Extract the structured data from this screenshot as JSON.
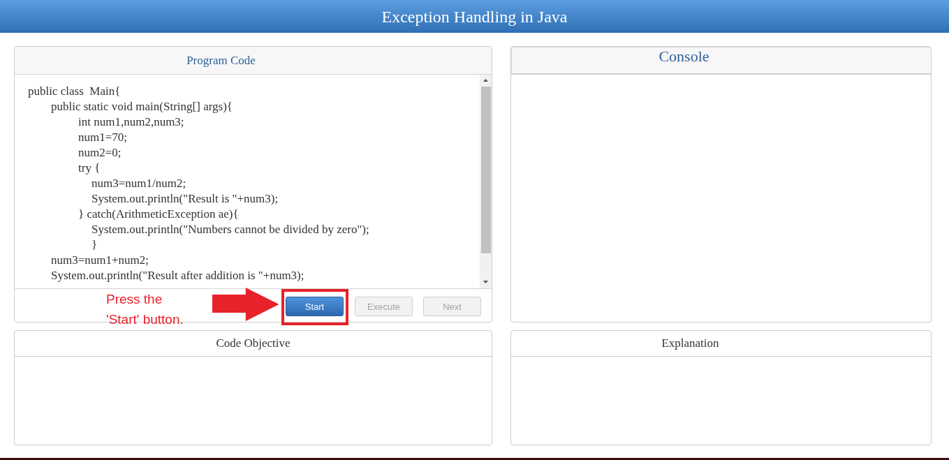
{
  "header": {
    "title": "Exception Handling in Java"
  },
  "program_code": {
    "title": "Program Code",
    "lines": [
      {
        "text": "public class  Main{",
        "children": [
          {
            "text": "public static void main(String[] args){",
            "children": [
              {
                "text": "int num1,num2,num3;"
              },
              {
                "text": "num1=70;"
              },
              {
                "text": "num2=0;"
              },
              {
                "text": "try {",
                "children": [
                  {
                    "text": "num3=num1/num2;"
                  },
                  {
                    "text": "System.out.println(\"Result is \"+num3);"
                  }
                ]
              },
              {
                "text": "} catch(ArithmeticException ae){",
                "children": [
                  {
                    "text": "System.out.println(\"Numbers cannot be divided by zero\");"
                  },
                  {
                    "text": "}"
                  }
                ]
              }
            ]
          },
          {
            "text": "num3=num1+num2;"
          },
          {
            "text": "System.out.println(\"Result after addition is \"+num3);"
          }
        ]
      }
    ],
    "annotation": "Press the\n'Start' button.",
    "buttons": [
      {
        "label": "Start",
        "disabled": false,
        "highlighted": true
      },
      {
        "label": "Execute",
        "disabled": true,
        "highlighted": false
      },
      {
        "label": "Next",
        "disabled": true,
        "highlighted": false
      }
    ]
  },
  "console": {
    "title": "Console"
  },
  "code_objective": {
    "title": "Code Objective"
  },
  "explanation": {
    "title": "Explanation"
  }
}
